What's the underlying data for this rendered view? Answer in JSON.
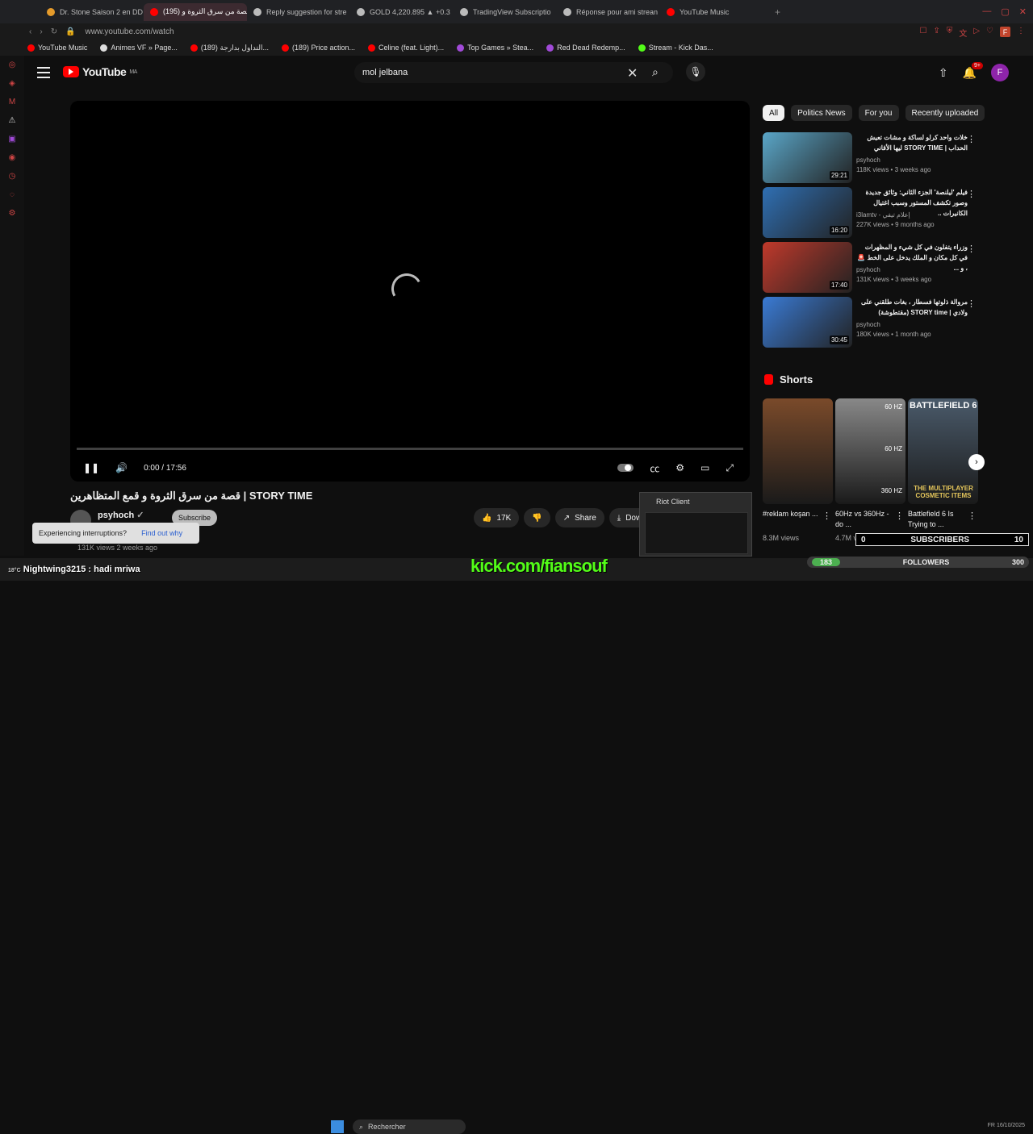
{
  "browser": {
    "tabs": [
      {
        "title": "Dr. Stone Saison 2 en DD",
        "color": "#e59b2b"
      },
      {
        "title": "(195) قصة من سرق الثروة و",
        "color": "#ff0000",
        "active": true
      },
      {
        "title": "Reply suggestion for stre",
        "color": "#bbbbbb"
      },
      {
        "title": "GOLD 4,220.895 ▲ +0.3",
        "color": "#bbbbbb"
      },
      {
        "title": "TradingView Subscriptio",
        "color": "#bbbbbb"
      },
      {
        "title": "Réponse pour ami strean",
        "color": "#bbbbbb"
      },
      {
        "title": "YouTube Music",
        "color": "#ff0000"
      }
    ],
    "url": "www.youtube.com/watch",
    "bookmarks": [
      {
        "label": "YouTube Music",
        "color": "#ff0000"
      },
      {
        "label": "Animes VF » Page...",
        "color": "#dddddd"
      },
      {
        "label": "(189) التداول بدارجة...",
        "color": "#ff0000"
      },
      {
        "label": "(189) Price action...",
        "color": "#ff0000"
      },
      {
        "label": "Celine (feat. Light)...",
        "color": "#ff0000"
      },
      {
        "label": "Top Games » Stea...",
        "color": "#a14ad8"
      },
      {
        "label": "Red Dead Redemp...",
        "color": "#a14ad8"
      },
      {
        "label": "Stream - Kick Das...",
        "color": "#53fc18"
      }
    ]
  },
  "header": {
    "logo_text": "YouTube",
    "logo_region": "MA",
    "search_value": "mol jelbana",
    "notif_count": "9+",
    "avatar_letter": "F"
  },
  "player": {
    "time": "0:00 / 17:56",
    "progress": 0
  },
  "video": {
    "title": "قصة من سرق الثروة و قمع المتظاهرين | STORY TIME",
    "channel": "psyhoch",
    "subscribe_label": "Subscribe",
    "likes": "17K",
    "share_label": "Share",
    "download_label": "Dow",
    "views_line": "131K views  2 weeks ago"
  },
  "tooltip": {
    "text": "Experiencing interruptions?",
    "link": "Find out why"
  },
  "chips": [
    "All",
    "Politics News",
    "For you",
    "Recently uploaded"
  ],
  "recommendations": [
    {
      "title": "خلات واحد كرلو لساكة و مشات تعيش الحداب | STORY TIME ليها الأقاني",
      "channel": "psyhoch",
      "meta": "118K views • 3 weeks ago",
      "duration": "29:21",
      "color": "#5aa6c8"
    },
    {
      "title": "فيلم 'ليلنصة' الجزء الثاني: وثائق جديدة وصور تكشف المستور وسبب اغتيال الكانيرات ..",
      "channel": "i3lamtv - إعلام تيفي",
      "meta": "227K views • 9 months ago",
      "duration": "16:20",
      "color": "#2f6fb3"
    },
    {
      "title": "وزراء يتفلون في كل شيء و المظهرات في كل مكان و الملك يدخل على الخط 🚨 ، و ...",
      "channel": "psyhoch",
      "meta": "131K views • 3 weeks ago",
      "duration": "17:40",
      "color": "#c0392b"
    },
    {
      "title": "مروالة ذلوتها فسطار ، بغات طلقني على ولادي | STORY time (مقتطوشة)",
      "channel": "psyhoch",
      "meta": "180K views • 1 month ago",
      "duration": "30:45",
      "color": "#3a7bd5"
    }
  ],
  "shorts": {
    "heading": "Shorts",
    "items": [
      {
        "title": "#reklam koşan ...",
        "views": "8.3M views",
        "color": "#7a4a2a"
      },
      {
        "title": "60Hz vs 360Hz - do ...",
        "views": "4.7M views",
        "color": "#888888",
        "labels": [
          "60 HZ",
          "60 HZ",
          "360 HZ"
        ]
      },
      {
        "title": "Battlefield 6 Is Trying to ...",
        "views": "",
        "color": "#4a5a6a",
        "overlay": "BATTLEFIELD 6",
        "sub_overlay": "THE MULTIPLAYER COSMETIC ITEMS"
      }
    ]
  },
  "riot_popup": {
    "title": "Riot Client"
  },
  "overlay": {
    "subs_left": "0",
    "subs_label": "SUBSCRIBERS",
    "subs_right": "10",
    "followers_left": "183",
    "followers_label": "FOLLOWERS",
    "followers_right": "300"
  },
  "taskbar": {
    "chat_line": "Nightwing3215 : hadi mriwa",
    "search_label": "Rechercher",
    "kick_text": "kick.com/fiansouf",
    "weather": "18°C",
    "lang": "FR",
    "date": "16/10/2025"
  }
}
